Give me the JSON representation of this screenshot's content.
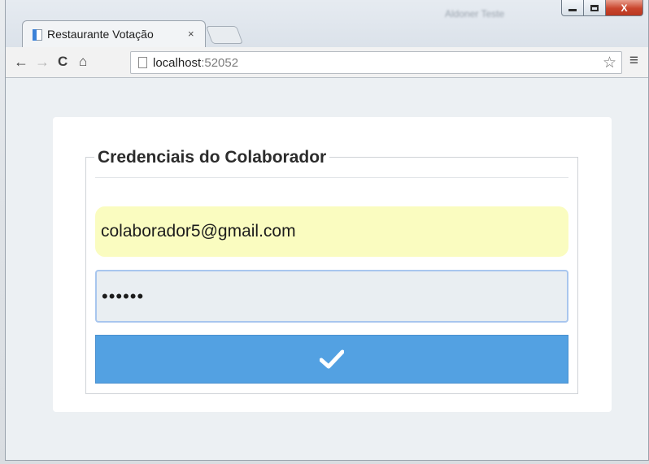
{
  "browser": {
    "window_title": "Aldoner Teste",
    "tab_title": "Restaurante Votação",
    "tab_close": "×",
    "url_host": "localhost",
    "url_port": ":52052",
    "caption_close": "X"
  },
  "form": {
    "legend": "Credenciais do Colaborador",
    "email_value": "colaborador5@gmail.com",
    "password_value": "••••••"
  },
  "colors": {
    "submit_button": "#53a1e2",
    "email_autofill_bg": "#fafcc0",
    "page_bg": "#ecf0f3"
  },
  "icons": {
    "back": "arrow-left-icon",
    "forward": "arrow-right-icon",
    "reload": "reload-icon",
    "home": "home-icon",
    "bookmark": "star-icon",
    "menu": "hamburger-menu-icon",
    "submit": "check-icon"
  }
}
